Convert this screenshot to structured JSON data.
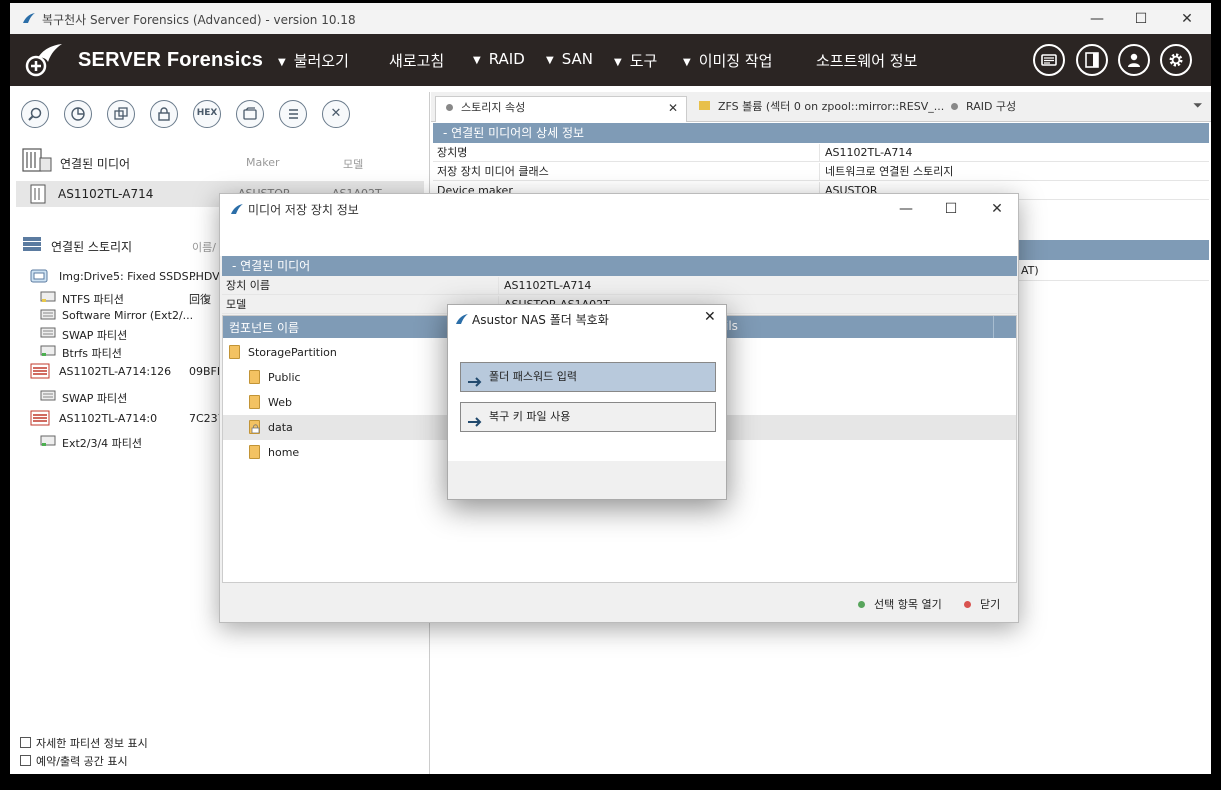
{
  "window": {
    "title": "복구천사 Server Forensics (Advanced) - version 10.18",
    "minimize": "—",
    "maximize": "☐",
    "close": "✕"
  },
  "menubar": {
    "brand": "SERVER Forensics",
    "items": [
      {
        "label": "불러오기",
        "has_arrow": true
      },
      {
        "label": "새로고침",
        "has_arrow": false
      },
      {
        "label": "RAID",
        "has_arrow": true
      },
      {
        "label": "SAN",
        "has_arrow": true
      },
      {
        "label": "도구",
        "has_arrow": true
      },
      {
        "label": "이미징 작업",
        "has_arrow": true
      },
      {
        "label": "소프트웨어 정보",
        "has_arrow": false
      }
    ],
    "arrow": "▼",
    "header_icons": [
      "drive-icon",
      "panel-icon",
      "user-icon",
      "settings-icon"
    ]
  },
  "left": {
    "toolbar": [
      {
        "name": "search-button",
        "glyph": ""
      },
      {
        "name": "chart-button",
        "glyph": ""
      },
      {
        "name": "copy-button",
        "glyph": ""
      },
      {
        "name": "lock-button",
        "glyph": ""
      },
      {
        "name": "hex-button",
        "glyph": "HEX"
      },
      {
        "name": "image-button",
        "glyph": ""
      },
      {
        "name": "list-button",
        "glyph": ""
      },
      {
        "name": "close-button",
        "glyph": "✕"
      }
    ],
    "media_header": "연결된 미디어",
    "media_col_maker": "Maker",
    "media_col_model": "모델",
    "media_row": {
      "name": "AS1102TL-A714",
      "maker": "ASUSTOR",
      "model": "AS1A02T"
    },
    "storage_header": "연결된 스토리지",
    "storage_col": "이름/",
    "storage_rows": [
      {
        "label": "Img:Drive5: Fixed SSDS...",
        "extra": "PHDV",
        "level": 0,
        "icon": "disk"
      },
      {
        "label": "NTFS 파티션",
        "extra": "回復",
        "level": 1,
        "icon": "part-yellow"
      },
      {
        "label": "Software Mirror (Ext2/...",
        "extra": "",
        "level": 1,
        "icon": "part-gray"
      },
      {
        "label": "SWAP 파티션",
        "extra": "",
        "level": 1,
        "icon": "part-gray"
      },
      {
        "label": "Btrfs 파티션",
        "extra": "",
        "level": 1,
        "icon": "part-green"
      },
      {
        "label": "AS1102TL-A714:126",
        "extra": "09BFD",
        "level": 0,
        "icon": "server"
      },
      {
        "label": "SWAP 파티션",
        "extra": "",
        "level": 1,
        "icon": "part-gray"
      },
      {
        "label": "AS1102TL-A714:0",
        "extra": "7C237",
        "level": 0,
        "icon": "server"
      },
      {
        "label": "Ext2/3/4 파티션",
        "extra": "",
        "level": 1,
        "icon": "part-green"
      }
    ],
    "check1": "자세한 파티션 정보 표시",
    "check2": "예약/출력 공간 표시"
  },
  "right": {
    "tabs": [
      {
        "label": "스토리지 속성",
        "close": "✕"
      },
      {
        "label": "ZFS 볼륨 (섹터 0 on zpool::mirror::RESV_..."
      },
      {
        "label": "RAID 구성"
      }
    ],
    "tab_menu": "⏷",
    "section": "-   연결된 미디어의 상세 정보",
    "rows": [
      {
        "k": "장치명",
        "v": "AS1102TL-A714"
      },
      {
        "k": "저장 장치 미디어 클래스",
        "v": "네트워크로 연결된 스토리지"
      },
      {
        "k": "Device maker",
        "v": "ASUSTOR"
      }
    ],
    "tail_text": "AT)"
  },
  "dialog_media": {
    "title": "미디어 저장 장치 정보",
    "minimize": "—",
    "maximize": "☐",
    "close": "✕",
    "section": "-   연결된 미디어",
    "rows": [
      {
        "k": "장치 이름",
        "v": "AS1102TL-A714"
      },
      {
        "k": "모델",
        "v": "ASUSTOR AS1A02T"
      }
    ],
    "col_name": "컴포넌트 이름",
    "col_details": "ils",
    "folders": [
      {
        "name": "StoragePartition",
        "level": 0,
        "locked": false,
        "selected": false
      },
      {
        "name": "Public",
        "level": 1,
        "locked": false,
        "selected": false
      },
      {
        "name": "Web",
        "level": 1,
        "locked": false,
        "selected": false
      },
      {
        "name": "data",
        "level": 1,
        "locked": true,
        "selected": true
      },
      {
        "name": "home",
        "level": 1,
        "locked": false,
        "selected": false
      }
    ],
    "open_btn": "선택 항목 열기",
    "close_btn": "닫기"
  },
  "dialog_decrypt": {
    "title": "Asustor NAS 폴더 복호화",
    "close": "✕",
    "options": [
      "폴더 패스워드 입력",
      "복구 키 파일 사용"
    ]
  },
  "colors": {
    "menubar": "#2b2523",
    "section": "#7f9bb6",
    "option_selected": "#b8c9dc",
    "open_dot": "#58a55c",
    "close_dot": "#d9534f"
  }
}
